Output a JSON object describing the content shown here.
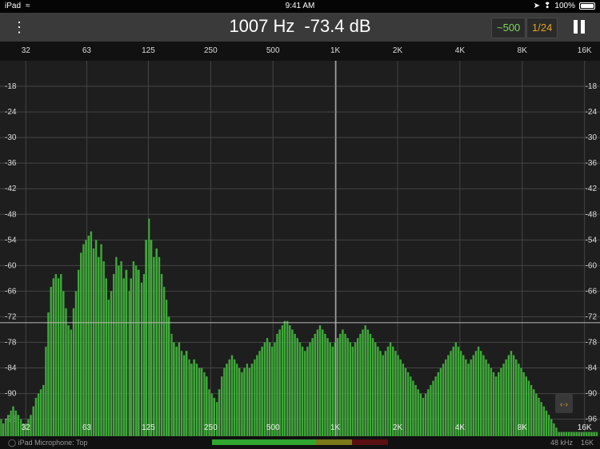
{
  "status_bar": {
    "time": "9:41 AM",
    "battery": "100%"
  },
  "toolbar": {
    "frequency": "1007 Hz",
    "level": "-73.4 dB",
    "smoothing_label": "~500",
    "resolution_label": "1/24"
  },
  "bottom_bar": {
    "input": "iPad Microphone: Top",
    "sample_rate": "48 kHz",
    "max_freq": "16K"
  },
  "colors": {
    "bars": "#3fa83a",
    "grid": "#555555",
    "accent": "#e2a125"
  },
  "chart_data": {
    "type": "bar",
    "x_scale": "log",
    "xlim": [
      24,
      19000
    ],
    "ylim": [
      -100,
      -12
    ],
    "x_ticks": [
      "32",
      "63",
      "125",
      "250",
      "500",
      "1K",
      "2K",
      "4K",
      "8K",
      "16K"
    ],
    "y_ticks": [
      "-18",
      "-24",
      "-30",
      "-36",
      "-42",
      "-48",
      "-54",
      "-60",
      "-66",
      "-72",
      "-78",
      "-84",
      "-90",
      "-96"
    ],
    "cursor": {
      "frequency": 1007,
      "level": -73.4
    },
    "x": [
      24.3,
      24.9,
      25.6,
      26.3,
      27.1,
      27.8,
      28.6,
      29.4,
      30.3,
      31.1,
      32.0,
      32.9,
      33.8,
      34.8,
      35.8,
      36.8,
      37.8,
      38.9,
      40.0,
      41.1,
      42.3,
      43.5,
      44.7,
      46.0,
      47.3,
      48.6,
      50.0,
      51.4,
      52.9,
      54.4,
      55.9,
      57.5,
      59.1,
      60.8,
      62.5,
      64.3,
      66.1,
      68.0,
      69.9,
      71.9,
      74.0,
      76.1,
      78.2,
      80.4,
      82.7,
      85.1,
      87.5,
      89.9,
      92.5,
      95.1,
      97.8,
      101,
      103,
      106,
      109,
      112,
      116,
      119,
      122,
      126,
      129,
      133,
      137,
      141,
      145,
      149,
      153,
      157,
      162,
      166,
      171,
      176,
      181,
      186,
      191,
      197,
      202,
      208,
      214,
      220,
      226,
      233,
      239,
      246,
      253,
      260,
      268,
      275,
      283,
      291,
      299,
      308,
      317,
      326,
      335,
      344,
      354,
      364,
      375,
      385,
      396,
      408,
      419,
      431,
      443,
      456,
      469,
      482,
      496,
      510,
      524,
      539,
      555,
      570,
      587,
      603,
      620,
      638,
      656,
      675,
      694,
      714,
      734,
      755,
      776,
      798,
      821,
      844,
      868,
      893,
      918,
      944,
      971,
      998,
      1027,
      1056,
      1086,
      1117,
      1148,
      1181,
      1214,
      1249,
      1284,
      1321,
      1358,
      1397,
      1436,
      1477,
      1519,
      1562,
      1606,
      1652,
      1699,
      1747,
      1796,
      1847,
      1900,
      1954,
      2009,
      2066,
      2125,
      2185,
      2247,
      2311,
      2376,
      2444,
      2513,
      2584,
      2658,
      2733,
      2811,
      2890,
      2972,
      3056,
      3143,
      3232,
      3324,
      3418,
      3515,
      3615,
      3717,
      3823,
      3931,
      4043,
      4157,
      4275,
      4397,
      4521,
      4649,
      4781,
      4917,
      5056,
      5200,
      5347,
      5499,
      5655,
      5815,
      5980,
      6150,
      6324,
      6503,
      6688,
      6877,
      7072,
      7273,
      7479,
      7691,
      7910,
      8134,
      8365,
      8602,
      8846,
      9097,
      9355,
      9620,
      9893,
      10174,
      10462,
      10759,
      11064,
      11378,
      11700,
      12032,
      12373,
      12724,
      13085,
      13456,
      13838,
      14230,
      14634,
      15049,
      15476,
      15914,
      16366,
      16830,
      17307,
      17798,
      18303
    ],
    "values": [
      -96,
      -97,
      -96,
      -95,
      -94,
      -93,
      -94,
      -95,
      -96,
      -97,
      -97,
      -96,
      -95,
      -93,
      -91,
      -90,
      -89,
      -88,
      -79,
      -71,
      -65,
      -63,
      -62,
      -63,
      -62,
      -66,
      -70,
      -74,
      -75,
      -70,
      -66,
      -61,
      -57,
      -55,
      -54,
      -53,
      -52,
      -56,
      -54,
      -58,
      -55,
      -59,
      -63,
      -68,
      -66,
      -62,
      -58,
      -60,
      -59,
      -63,
      -61,
      -66,
      -63,
      -59,
      -60,
      -61,
      -64,
      -62,
      -54,
      -49,
      -54,
      -58,
      -56,
      -58,
      -62,
      -65,
      -68,
      -72,
      -76,
      -78,
      -79,
      -78,
      -80,
      -81,
      -80,
      -82,
      -83,
      -82,
      -83,
      -84,
      -84,
      -85,
      -86,
      -89,
      -90,
      -91,
      -92,
      -89,
      -86,
      -84,
      -83,
      -82,
      -81,
      -82,
      -83,
      -84,
      -85,
      -84,
      -83,
      -84,
      -83,
      -82,
      -81,
      -80,
      -79,
      -78,
      -77,
      -78,
      -79,
      -78,
      -76,
      -75,
      -74,
      -73,
      -73,
      -74,
      -75,
      -76,
      -77,
      -78,
      -79,
      -80,
      -79,
      -78,
      -77,
      -76,
      -75,
      -74,
      -75,
      -76,
      -77,
      -78,
      -79,
      -78,
      -77,
      -76,
      -75,
      -76,
      -77,
      -78,
      -79,
      -78,
      -77,
      -76,
      -75,
      -74,
      -75,
      -76,
      -77,
      -78,
      -79,
      -80,
      -81,
      -80,
      -79,
      -78,
      -79,
      -80,
      -81,
      -82,
      -83,
      -84,
      -85,
      -86,
      -87,
      -88,
      -89,
      -90,
      -91,
      -90,
      -89,
      -88,
      -87,
      -86,
      -85,
      -84,
      -83,
      -82,
      -81,
      -80,
      -79,
      -78,
      -79,
      -80,
      -81,
      -82,
      -83,
      -82,
      -81,
      -80,
      -79,
      -80,
      -81,
      -82,
      -83,
      -84,
      -85,
      -86,
      -85,
      -84,
      -83,
      -82,
      -81,
      -80,
      -81,
      -82,
      -83,
      -84,
      -85,
      -86,
      -87,
      -88,
      -89,
      -90,
      -91,
      -92,
      -93,
      -94,
      -95,
      -96,
      -97,
      -98,
      -99,
      -99,
      -99,
      -99,
      -99,
      -99,
      -99,
      -99,
      -99,
      -99,
      -99,
      -99,
      -99,
      -99,
      -99,
      -99
    ]
  }
}
